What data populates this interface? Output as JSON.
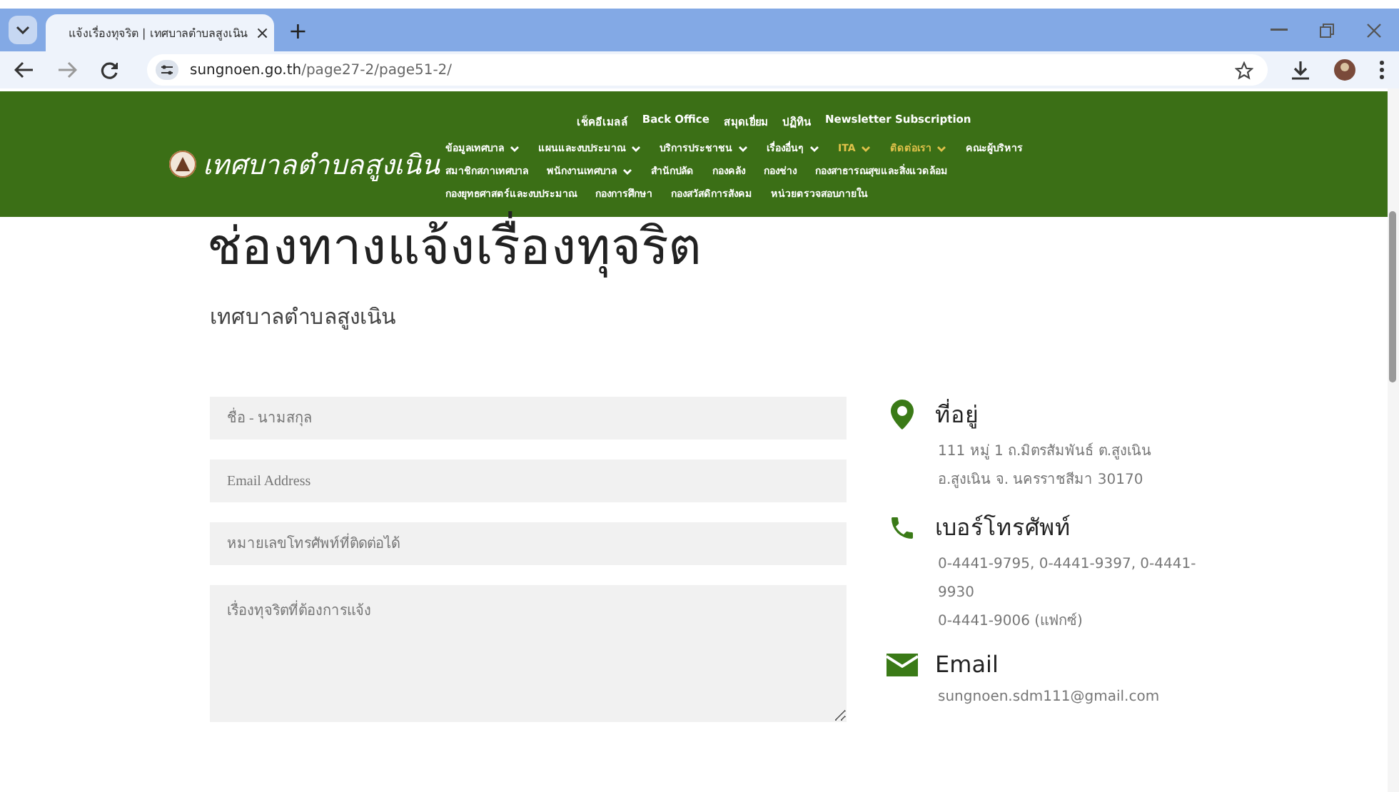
{
  "browser": {
    "tab_title": "แจ้งเรื่องทุจริต | เทศบาลตำบลสูงเนิน",
    "tab_close": "×",
    "new_tab": "+",
    "url_host": "sungnoen.go.th",
    "url_path": "/page27-2/page51-2/"
  },
  "site": {
    "name": "เทศบาลตำบลสูงเนิน",
    "top_links": [
      "เช็คอีเมลล์",
      "Back Office",
      "สมุดเยี่ยม",
      "ปฏิทิน",
      "Newsletter Subscription"
    ],
    "menu_rows": [
      [
        {
          "label": "ข้อมูลเทศบาล",
          "dropdown": true,
          "highlighted": false
        },
        {
          "label": "แผนและงบประมาณ",
          "dropdown": true,
          "highlighted": false
        },
        {
          "label": "บริการประชาชน",
          "dropdown": true,
          "highlighted": false
        },
        {
          "label": "เรื่องอื่นๆ",
          "dropdown": true,
          "highlighted": false
        },
        {
          "label": "ITA",
          "dropdown": true,
          "highlighted": true
        },
        {
          "label": "ติดต่อเรา",
          "dropdown": true,
          "highlighted": true
        },
        {
          "label": "คณะผู้บริหาร",
          "dropdown": false,
          "highlighted": false
        }
      ],
      [
        {
          "label": "สมาชิกสภาเทศบาล",
          "dropdown": false,
          "highlighted": false
        },
        {
          "label": "พนักงานเทศบาล",
          "dropdown": true,
          "highlighted": false
        },
        {
          "label": "สำนักปลัด",
          "dropdown": false,
          "highlighted": false
        },
        {
          "label": "กองคลัง",
          "dropdown": false,
          "highlighted": false
        },
        {
          "label": "กองช่าง",
          "dropdown": false,
          "highlighted": false
        },
        {
          "label": "กองสาธารณสุขและสิ่งแวดล้อม",
          "dropdown": false,
          "highlighted": false
        }
      ],
      [
        {
          "label": "กองยุทธศาสตร์และงบประมาณ",
          "dropdown": false,
          "highlighted": false
        },
        {
          "label": "กองการศึกษา",
          "dropdown": false,
          "highlighted": false
        },
        {
          "label": "กองสวัสดิการสังคม",
          "dropdown": false,
          "highlighted": false
        },
        {
          "label": "หน่วยตรวจสอบภายใน",
          "dropdown": false,
          "highlighted": false
        }
      ]
    ]
  },
  "page": {
    "title": "ช่องทางแจ้งเรื่องทุจริต",
    "subtitle": "เทศบาลตำบลสูงเนิน"
  },
  "form": {
    "fields": [
      {
        "kind": "input",
        "placeholder": "ชื่อ - นามสกุล"
      },
      {
        "kind": "input",
        "placeholder": "Email Address"
      },
      {
        "kind": "input",
        "placeholder": "หมายเลขโทรศัพท์ที่ติดต่อได้"
      },
      {
        "kind": "textarea",
        "placeholder": "เรื่องทุจริตที่ต้องการแจ้ง"
      }
    ]
  },
  "contact": [
    {
      "kind": "address",
      "heading": "ที่อยู่",
      "lines": [
        "111 หมู่ 1 ถ.มิตรสัมพันธ์ ต.สูงเนิน",
        "อ.สูงเนิน จ. นครราชสีมา 30170"
      ]
    },
    {
      "kind": "phone",
      "heading": "เบอร์โทรศัพท์",
      "lines": [
        "0-4441-9795, 0-4441-9397, 0-4441-9930",
        "0-4441-9006 (แฟกซ์)"
      ]
    },
    {
      "kind": "email",
      "heading": "Email",
      "lines": [
        "sungnoen.sdm111@gmail.com"
      ]
    }
  ]
}
